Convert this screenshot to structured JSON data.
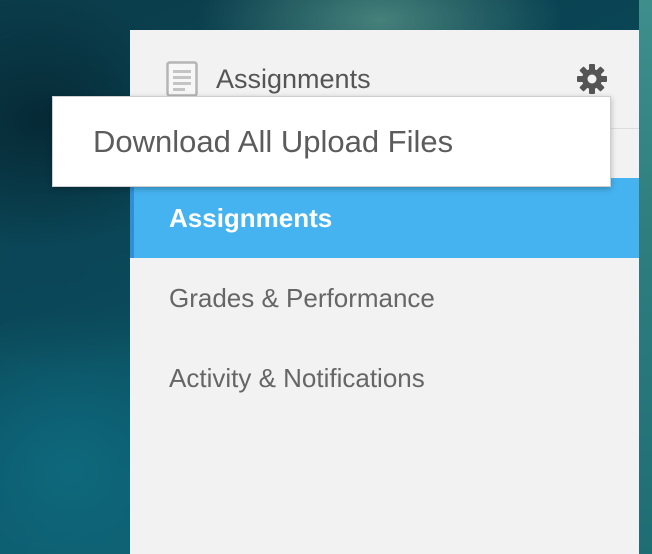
{
  "header": {
    "title": "Assignments",
    "doc_icon": "document-icon",
    "settings_icon": "gear-icon"
  },
  "dropdown": {
    "items": [
      {
        "label": "Download All Upload Files"
      }
    ]
  },
  "nav": {
    "items": [
      {
        "label": "Assignments",
        "active": true
      },
      {
        "label": "Grades & Performance",
        "active": false
      },
      {
        "label": "Activity & Notifications",
        "active": false
      }
    ]
  },
  "colors": {
    "accent": "#45b3f0",
    "accent_border": "#2f8fd6",
    "panel_bg": "#f2f2f2",
    "text": "#666666"
  }
}
